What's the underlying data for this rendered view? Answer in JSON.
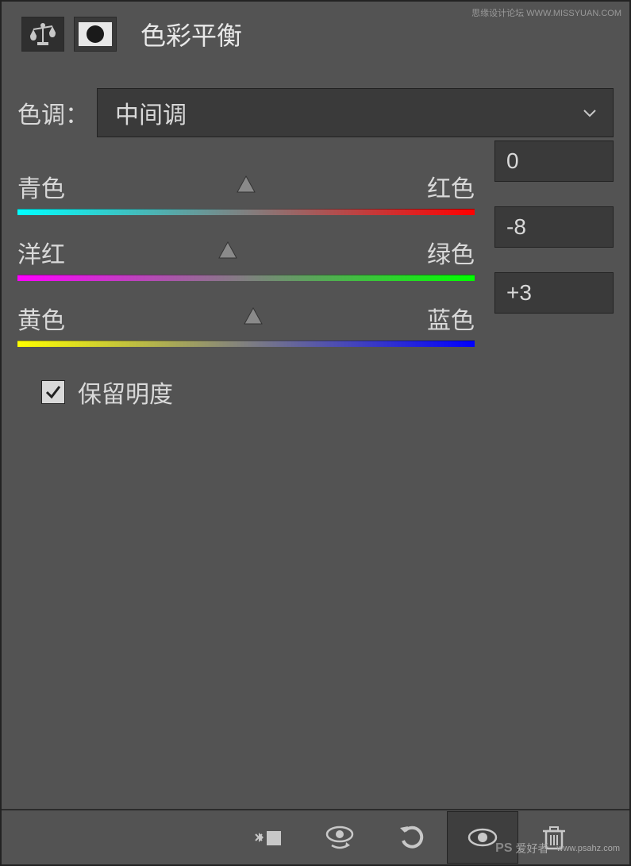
{
  "header": {
    "title": "色彩平衡"
  },
  "tone": {
    "label": "色调：",
    "selected": "中间调"
  },
  "sliders": {
    "cyan_red": {
      "left_label": "青色",
      "right_label": "红色",
      "value": "0",
      "handle_percent": 50
    },
    "magenta_green": {
      "left_label": "洋红",
      "right_label": "绿色",
      "value": "-8",
      "handle_percent": 46
    },
    "yellow_blue": {
      "left_label": "黄色",
      "right_label": "蓝色",
      "value": "+3",
      "handle_percent": 51.5
    }
  },
  "preserve": {
    "label": "保留明度",
    "checked": true
  },
  "watermarks": {
    "top": "思缘设计论坛  WWW.MISSYUAN.COM",
    "bottom_logo": "PS",
    "bottom_text": "爱好者",
    "bottom_url": "www.psahz.com"
  }
}
